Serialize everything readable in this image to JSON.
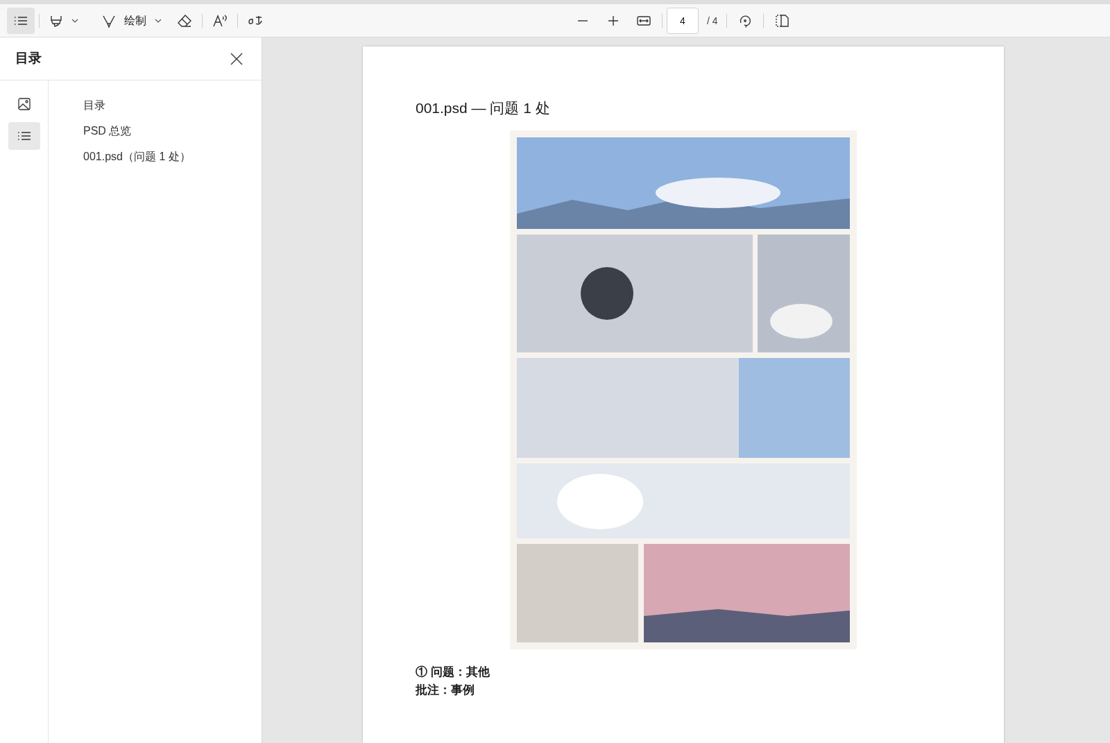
{
  "toolbar": {
    "contents_button": {
      "selected": true
    },
    "draw_label": "绘制",
    "page_input": {
      "value": "4"
    },
    "page_total": "/ 4"
  },
  "sidebar": {
    "title": "目录",
    "tabs": [
      {
        "kind": "thumbnails",
        "selected": false
      },
      {
        "kind": "outline",
        "selected": true
      }
    ],
    "items": [
      {
        "label": "目录"
      },
      {
        "label": "PSD 总览"
      },
      {
        "label": "001.psd（问题 1 处）"
      }
    ]
  },
  "page": {
    "heading": "001.psd — 问题 1 处",
    "figure": {
      "kind": "picture"
    },
    "notes": [
      "① 问题：其他",
      "批注：事例"
    ]
  }
}
